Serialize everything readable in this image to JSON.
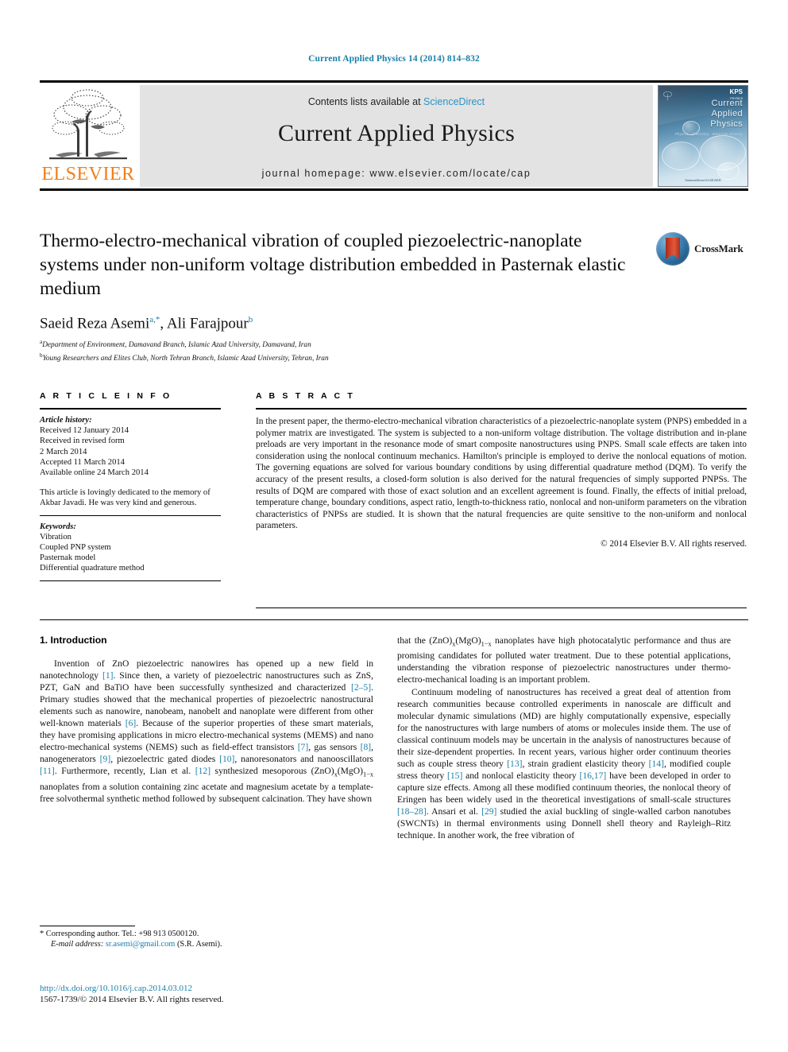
{
  "running_head": "Current Applied Physics 14 (2014) 814–832",
  "masthead": {
    "publisher_logo_text": "ELSEVIER",
    "contents_prefix": "Contents lists available at ",
    "contents_link": "ScienceDirect",
    "journal_name": "Current Applied Physics",
    "homepage_label": "journal homepage: www.elsevier.com/locate/cap",
    "cover": {
      "title_line1": "Current",
      "title_line2": "Applied",
      "title_line3": "Physics",
      "subtitle": "Physics · Chemistry · Materials Science",
      "badge": "KPS",
      "badge_sub": "PHYSICS",
      "footer": "ScienceDirect  ELSEVIER"
    }
  },
  "article": {
    "title": "Thermo-electro-mechanical vibration of coupled piezoelectric-nanoplate systems under non-uniform voltage distribution embedded in Pasternak elastic medium",
    "authors": [
      {
        "name": "Saeid Reza Asemi",
        "marks": "a,*"
      },
      {
        "name": "Ali Farajpour",
        "marks": "b"
      }
    ],
    "affiliations": [
      {
        "mark": "a",
        "text": "Department of Environment, Damavand Branch, Islamic Azad University, Damavand, Iran"
      },
      {
        "mark": "b",
        "text": "Young Researchers and Elites Club, North Tehran Branch, Islamic Azad University, Tehran, Iran"
      }
    ],
    "crossmark_label": "CrossMark"
  },
  "article_info": {
    "heading": "A R T I C L E    I N F O",
    "history_label": "Article history:",
    "history": [
      "Received 12 January 2014",
      "Received in revised form",
      "2 March 2014",
      "Accepted 11 March 2014",
      "Available online 24 March 2014"
    ],
    "dedication": "This article is lovingly dedicated to the memory of Akbar Javadi. He was very kind and generous.",
    "keywords_label": "Keywords:",
    "keywords": [
      "Vibration",
      "Coupled PNP system",
      "Pasternak model",
      "Differential quadrature method"
    ]
  },
  "abstract": {
    "heading": "A B S T R A C T",
    "text": "In the present paper, the thermo-electro-mechanical vibration characteristics of a piezoelectric-nanoplate system (PNPS) embedded in a polymer matrix are investigated. The system is subjected to a non-uniform voltage distribution. The voltage distribution and in-plane preloads are very important in the resonance mode of smart composite nanostructures using PNPS. Small scale effects are taken into consideration using the nonlocal continuum mechanics. Hamilton's principle is employed to derive the nonlocal equations of motion. The governing equations are solved for various boundary conditions by using differential quadrature method (DQM). To verify the accuracy of the present results, a closed-form solution is also derived for the natural frequencies of simply supported PNPSs. The results of DQM are compared with those of exact solution and an excellent agreement is found. Finally, the effects of initial preload, temperature change, boundary conditions, aspect ratio, length-to-thickness ratio, nonlocal and non-uniform parameters on the vibration characteristics of PNPSs are studied. It is shown that the natural frequencies are quite sensitive to the non-uniform and nonlocal parameters.",
    "copyright": "© 2014 Elsevier B.V. All rights reserved."
  },
  "body": {
    "section_title": "1. Introduction",
    "left_paragraphs": [
      {
        "segments": [
          {
            "t": "Invention of ZnO piezoelectric nanowires has opened up a new field in nanotechnology "
          },
          {
            "t": "[1]",
            "ref": true
          },
          {
            "t": ". Since then, a variety of piezoelectric nanostructures such as ZnS, PZT, GaN and BaTiO have been successfully synthesized and characterized "
          },
          {
            "t": "[2–5]",
            "ref": true
          },
          {
            "t": ". Primary studies showed that the mechanical properties of piezoelectric nanostructural elements such as nanowire, nanobeam, nanobelt and nanoplate were different from other well-known materials "
          },
          {
            "t": "[6]",
            "ref": true
          },
          {
            "t": ". Because of the superior properties of these smart materials, they have promising applications in micro electro-mechanical systems (MEMS) and nano electro-mechanical systems (NEMS) such as field-effect transistors "
          },
          {
            "t": "[7]",
            "ref": true
          },
          {
            "t": ", gas sensors "
          },
          {
            "t": "[8]",
            "ref": true
          },
          {
            "t": ", nanogenerators "
          },
          {
            "t": "[9]",
            "ref": true
          },
          {
            "t": ", piezoelectric gated diodes "
          },
          {
            "t": "[10]",
            "ref": true
          },
          {
            "t": ", nanoresonators and nanooscillators "
          },
          {
            "t": "[11]",
            "ref": true
          },
          {
            "t": ". Furthermore, recently, Lian et al. "
          },
          {
            "t": "[12]",
            "ref": true
          },
          {
            "t": " synthesized mesoporous (ZnO)"
          },
          {
            "t": "x",
            "sub": true
          },
          {
            "t": "(MgO)"
          },
          {
            "t": "1−x",
            "sub": true
          },
          {
            "t": " nanoplates from a solution containing zinc acetate and magnesium acetate by a template-free solvothermal synthetic method followed by subsequent calcination. They have shown"
          }
        ]
      }
    ],
    "right_paragraphs": [
      {
        "continued": true,
        "segments": [
          {
            "t": "that the (ZnO)"
          },
          {
            "t": "x",
            "sub": true
          },
          {
            "t": "(MgO)"
          },
          {
            "t": "1−x",
            "sub": true
          },
          {
            "t": " nanoplates have high photocatalytic performance and thus are promising candidates for polluted water treatment. Due to these potential applications, understanding the vibration response of piezoelectric nanostructures under thermo-electro-mechanical loading is an important problem."
          }
        ]
      },
      {
        "continued": false,
        "segments": [
          {
            "t": "Continuum modeling of nanostructures has received a great deal of attention from research communities because controlled experiments in nanoscale are difficult and molecular dynamic simulations (MD) are highly computationally expensive, especially for the nanostructures with large numbers of atoms or molecules inside them. The use of classical continuum models may be uncertain in the analysis of nanostructures because of their size-dependent properties. In recent years, various higher order continuum theories such as couple stress theory "
          },
          {
            "t": "[13]",
            "ref": true
          },
          {
            "t": ", strain gradient elasticity theory "
          },
          {
            "t": "[14]",
            "ref": true
          },
          {
            "t": ", modified couple stress theory "
          },
          {
            "t": "[15]",
            "ref": true
          },
          {
            "t": " and nonlocal elasticity theory "
          },
          {
            "t": "[16,17]",
            "ref": true
          },
          {
            "t": " have been developed in order to capture size effects. Among all these modified continuum theories, the nonlocal theory of Eringen has been widely used in the theoretical investigations of small-scale structures "
          },
          {
            "t": "[18–28]",
            "ref": true
          },
          {
            "t": ". Ansari et al. "
          },
          {
            "t": "[29]",
            "ref": true
          },
          {
            "t": " studied the axial buckling of single-walled carbon nanotubes (SWCNTs) in thermal environments using Donnell shell theory and Rayleigh–Ritz technique. In another work, the free vibration of"
          }
        ]
      }
    ]
  },
  "footnote": {
    "star": "*",
    "corresponding": " Corresponding author. Tel.: +98 913 0500120.",
    "email_label": "E-mail address:",
    "email": "sr.asemi@gmail.com",
    "email_owner": " (S.R. Asemi)."
  },
  "doi_block": {
    "doi": "http://dx.doi.org/10.1016/j.cap.2014.03.012",
    "issn_line": "1567-1739/© 2014 Elsevier B.V. All rights reserved."
  },
  "colors": {
    "link": "#1b7fa8",
    "sciencedirect": "#2a93c9",
    "elsevier_orange": "#F07F1A",
    "masthead_bg": "#e3e3e3"
  }
}
